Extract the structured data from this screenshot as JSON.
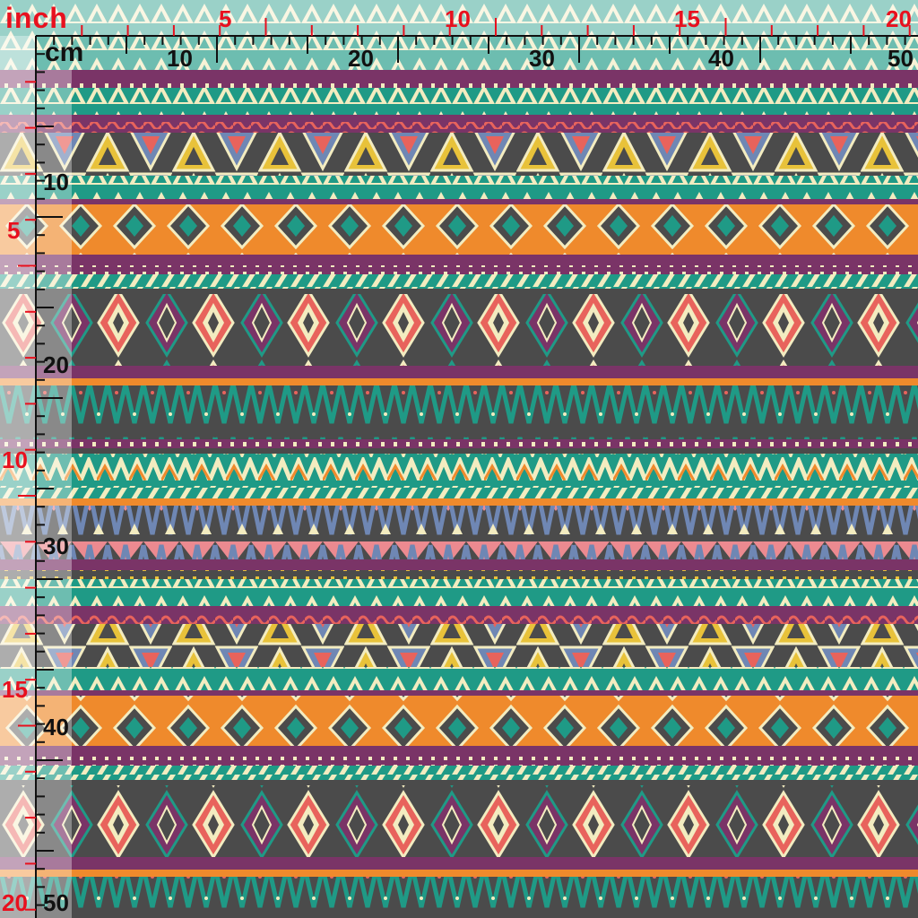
{
  "ruler": {
    "inch_label": "inch",
    "cm_label": "cm",
    "top_inch_numbers": [
      "5",
      "10",
      "15",
      "20"
    ],
    "top_cm_numbers": [
      "10",
      "20",
      "30",
      "40",
      "50"
    ],
    "left_inch_numbers": [
      "5",
      "10",
      "15",
      "20"
    ],
    "left_cm_numbers": [
      "10",
      "20",
      "30",
      "40",
      "50"
    ],
    "inch_color": "#e8101e",
    "cm_color": "#111111"
  },
  "fabric": {
    "pattern": "aztec-tribal-stripes",
    "colors": {
      "purple": "#7a3467",
      "teal": "#1f9a86",
      "orange": "#ef8a2c",
      "coral": "#e8635c",
      "charcoal": "#4b4b4b",
      "cream": "#f3ecc0",
      "yellow": "#e8c23a",
      "blue": "#6f87b4",
      "pink": "#ec8a90"
    }
  }
}
